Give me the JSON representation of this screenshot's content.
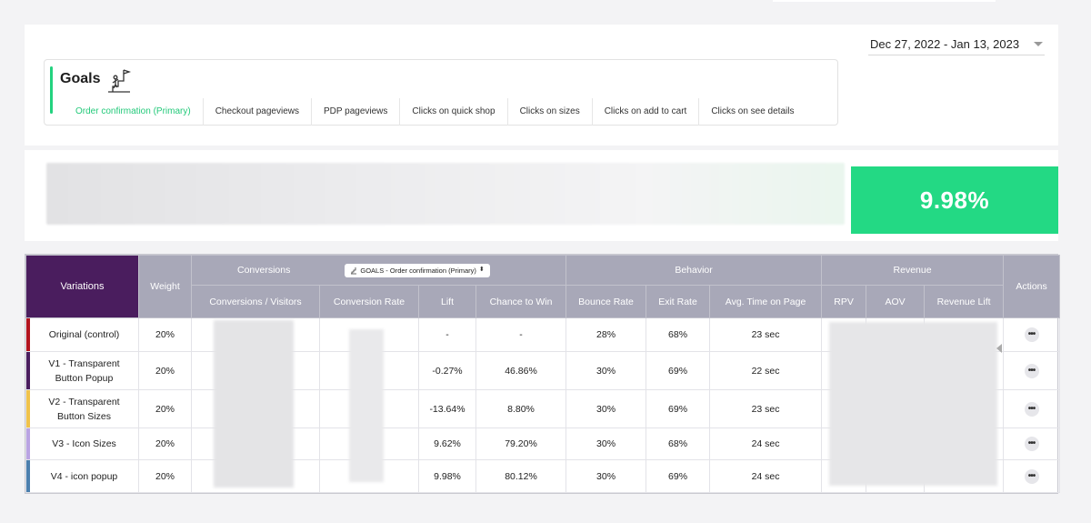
{
  "header": {
    "date_range": "Dec 27, 2022 - Jan 13, 2023"
  },
  "goals": {
    "title": "Goals",
    "icon": "stairs-flag-icon",
    "tabs": [
      {
        "label": "Order confirmation (Primary)",
        "active": true
      },
      {
        "label": "Checkout pageviews",
        "active": false
      },
      {
        "label": "PDP pageviews",
        "active": false
      },
      {
        "label": "Clicks on quick shop",
        "active": false
      },
      {
        "label": "Clicks on sizes",
        "active": false
      },
      {
        "label": "Clicks on add to cart",
        "active": false
      },
      {
        "label": "Clicks on see details",
        "active": false
      }
    ]
  },
  "summary": {
    "metric": "9.98%",
    "accent_color": "#23d984"
  },
  "table": {
    "headers": {
      "variations": "Variations",
      "weight": "Weight",
      "conversions_group": "Conversions",
      "goal_selector": "GOALS - Order confirmation (Primary)",
      "behavior_group": "Behavior",
      "revenue_group": "Revenue",
      "actions": "Actions",
      "conversions_visitors": "Conversions / Visitors",
      "conversion_rate": "Conversion Rate",
      "lift": "Lift",
      "chance_to_win": "Chance to Win",
      "bounce_rate": "Bounce Rate",
      "exit_rate": "Exit Rate",
      "avg_time": "Avg. Time on Page",
      "rpv": "RPV",
      "aov": "AOV",
      "revenue_lift": "Revenue Lift"
    },
    "rows": [
      {
        "name": "Original (control)",
        "color": "#b3141e",
        "weight": "20%",
        "lift": "-",
        "chance": "-",
        "bounce": "28%",
        "exit": "68%",
        "time": "23 sec"
      },
      {
        "name": "V1 - Transparent Button Popup",
        "color": "#4a1d5e",
        "weight": "20%",
        "lift": "-0.27%",
        "chance": "46.86%",
        "bounce": "30%",
        "exit": "69%",
        "time": "22 sec"
      },
      {
        "name": "V2 - Transparent Button Sizes",
        "color": "#f0c24a",
        "weight": "20%",
        "lift": "-13.64%",
        "chance": "8.80%",
        "bounce": "30%",
        "exit": "69%",
        "time": "23 sec"
      },
      {
        "name": "V3 - Icon Sizes",
        "color": "#b9a3e3",
        "weight": "20%",
        "lift": "9.62%",
        "chance": "79.20%",
        "bounce": "30%",
        "exit": "68%",
        "time": "24 sec"
      },
      {
        "name": "V4 - icon popup",
        "color": "#4b7fae",
        "weight": "20%",
        "lift": "9.98%",
        "chance": "80.12%",
        "bounce": "30%",
        "exit": "69%",
        "time": "24 sec"
      }
    ],
    "action_icon": "more-dots-icon"
  }
}
